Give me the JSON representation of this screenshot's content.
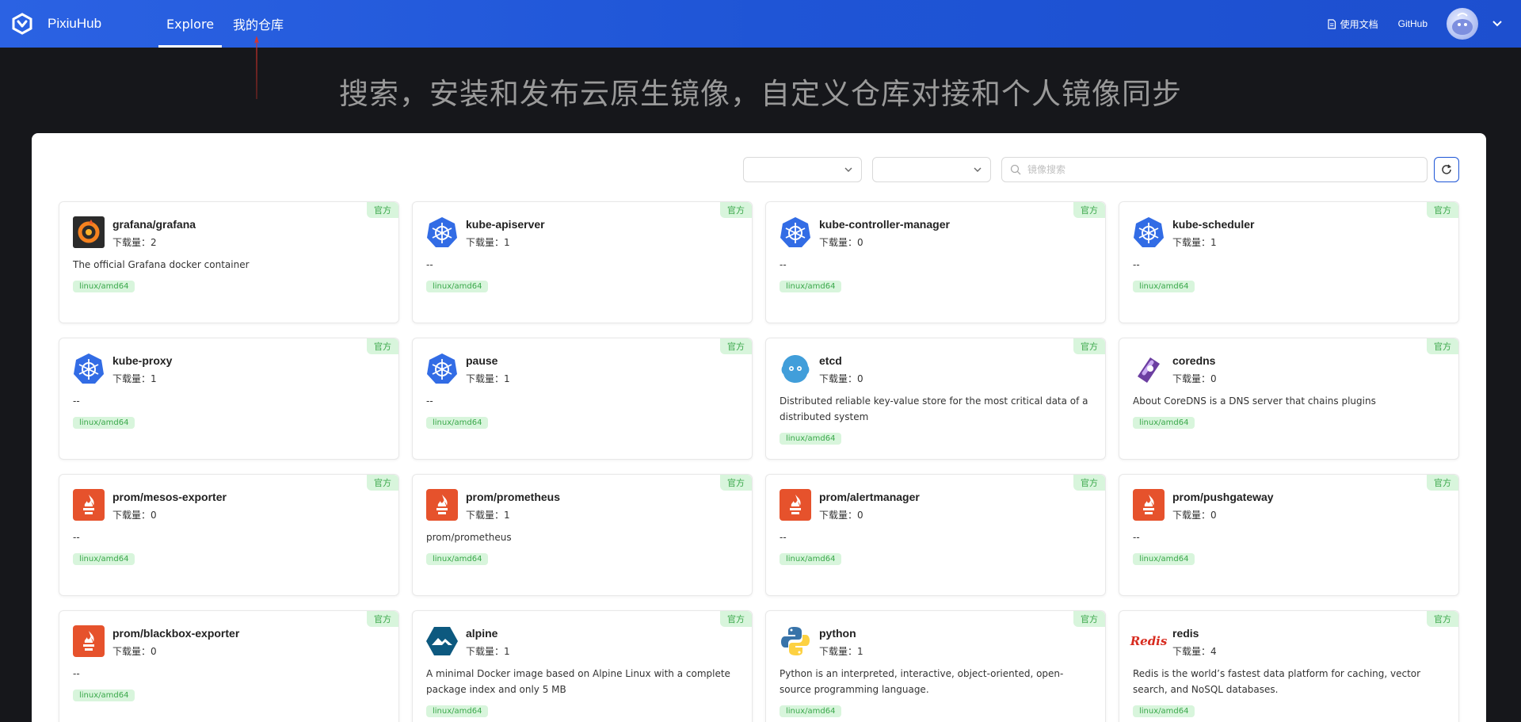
{
  "header": {
    "brand": "PixiuHub",
    "nav": [
      {
        "label": "Explore",
        "active": true
      },
      {
        "label": "我的仓库",
        "active": false
      }
    ],
    "docs_label": "使用文档",
    "github_label": "GitHub",
    "accent_color": "#1f55d6"
  },
  "hero": {
    "title": "搜索，安装和发布云原生镜像，自定义仓库对接和个人镜像同步"
  },
  "filters": {
    "search_placeholder": "镜像搜索",
    "select1_value": "",
    "select2_value": ""
  },
  "download_prefix": "下载量：",
  "cards": [
    {
      "name": "grafana/grafana",
      "downloads": "2",
      "description": "The official Grafana docker container",
      "tag": "linux/amd64",
      "badge": "官方",
      "icon": "grafana-icon"
    },
    {
      "name": "kube-apiserver",
      "downloads": "1",
      "description": "--",
      "tag": "linux/amd64",
      "badge": "官方",
      "icon": "kubernetes-icon"
    },
    {
      "name": "kube-controller-manager",
      "downloads": "0",
      "description": "--",
      "tag": "linux/amd64",
      "badge": "官方",
      "icon": "kubernetes-icon"
    },
    {
      "name": "kube-scheduler",
      "downloads": "1",
      "description": "--",
      "tag": "linux/amd64",
      "badge": "官方",
      "icon": "kubernetes-icon"
    },
    {
      "name": "kube-proxy",
      "downloads": "1",
      "description": "--",
      "tag": "linux/amd64",
      "badge": "官方",
      "icon": "kubernetes-icon"
    },
    {
      "name": "pause",
      "downloads": "1",
      "description": "--",
      "tag": "linux/amd64",
      "badge": "官方",
      "icon": "kubernetes-icon"
    },
    {
      "name": "etcd",
      "downloads": "0",
      "description": "Distributed reliable key-value store for the most critical data of a distributed system",
      "tag": "linux/amd64",
      "badge": "官方",
      "icon": "etcd-icon"
    },
    {
      "name": "coredns",
      "downloads": "0",
      "description": "About CoreDNS is a DNS server that chains plugins",
      "tag": "linux/amd64",
      "badge": "官方",
      "icon": "coredns-icon"
    },
    {
      "name": "prom/mesos-exporter",
      "downloads": "0",
      "description": "--",
      "tag": "linux/amd64",
      "badge": "官方",
      "icon": "prometheus-icon"
    },
    {
      "name": "prom/prometheus",
      "downloads": "1",
      "description": "prom/prometheus",
      "tag": "linux/amd64",
      "badge": "官方",
      "icon": "prometheus-icon"
    },
    {
      "name": "prom/alertmanager",
      "downloads": "0",
      "description": "--",
      "tag": "linux/amd64",
      "badge": "官方",
      "icon": "prometheus-icon"
    },
    {
      "name": "prom/pushgateway",
      "downloads": "0",
      "description": "--",
      "tag": "linux/amd64",
      "badge": "官方",
      "icon": "prometheus-icon"
    },
    {
      "name": "prom/blackbox-exporter",
      "downloads": "0",
      "description": "--",
      "tag": "linux/amd64",
      "badge": "官方",
      "icon": "prometheus-icon"
    },
    {
      "name": "alpine",
      "downloads": "1",
      "description": "A minimal Docker image based on Alpine Linux with a complete package index and only 5 MB",
      "tag": "linux/amd64",
      "badge": "官方",
      "icon": "alpine-icon"
    },
    {
      "name": "python",
      "downloads": "1",
      "description": "Python is an interpreted, interactive, object-oriented, open-source programming language.",
      "tag": "linux/amd64",
      "badge": "官方",
      "icon": "python-icon"
    },
    {
      "name": "redis",
      "downloads": "4",
      "description": "Redis is the world’s fastest data platform for caching, vector search, and NoSQL databases.",
      "tag": "linux/amd64",
      "badge": "官方",
      "icon": "redis-icon",
      "icon_text": "Redis"
    }
  ]
}
